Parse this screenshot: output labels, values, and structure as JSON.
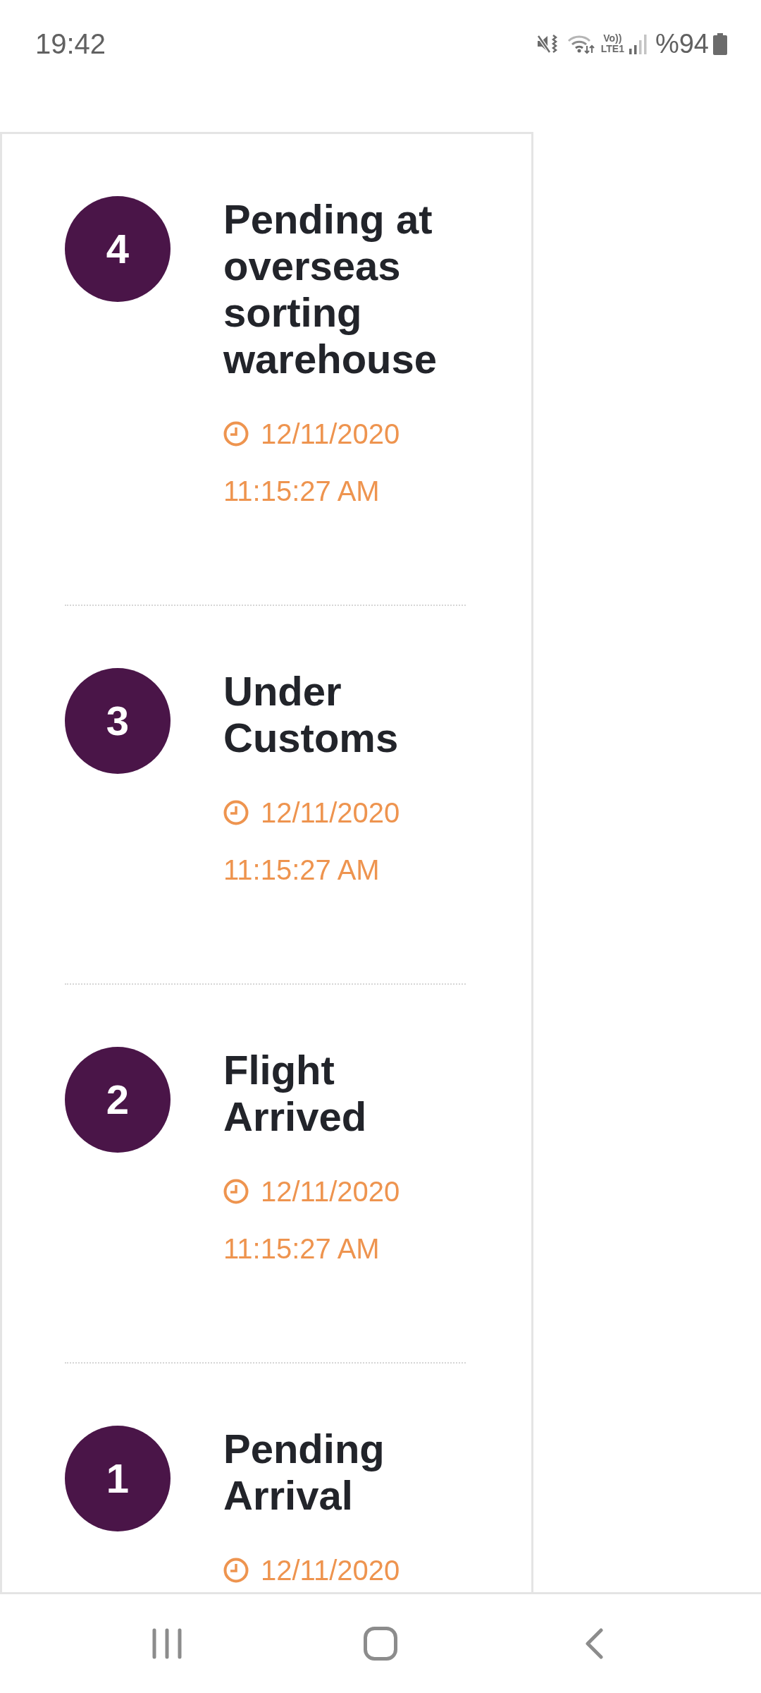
{
  "status_bar": {
    "time": "19:42",
    "network": {
      "volte": "Vo))",
      "type": "LTE1"
    },
    "battery": "%94"
  },
  "timeline": [
    {
      "step": "4",
      "title": "Pending at overseas sorting warehouse",
      "date": "12/11/2020",
      "time": "11:15:27 AM"
    },
    {
      "step": "3",
      "title": "Under Customs",
      "date": "12/11/2020",
      "time": "11:15:27 AM"
    },
    {
      "step": "2",
      "title": "Flight Arrived",
      "date": "12/11/2020",
      "time": "11:15:27 AM"
    },
    {
      "step": "1",
      "title": "Pending Arrival",
      "date": "12/11/2020"
    }
  ]
}
